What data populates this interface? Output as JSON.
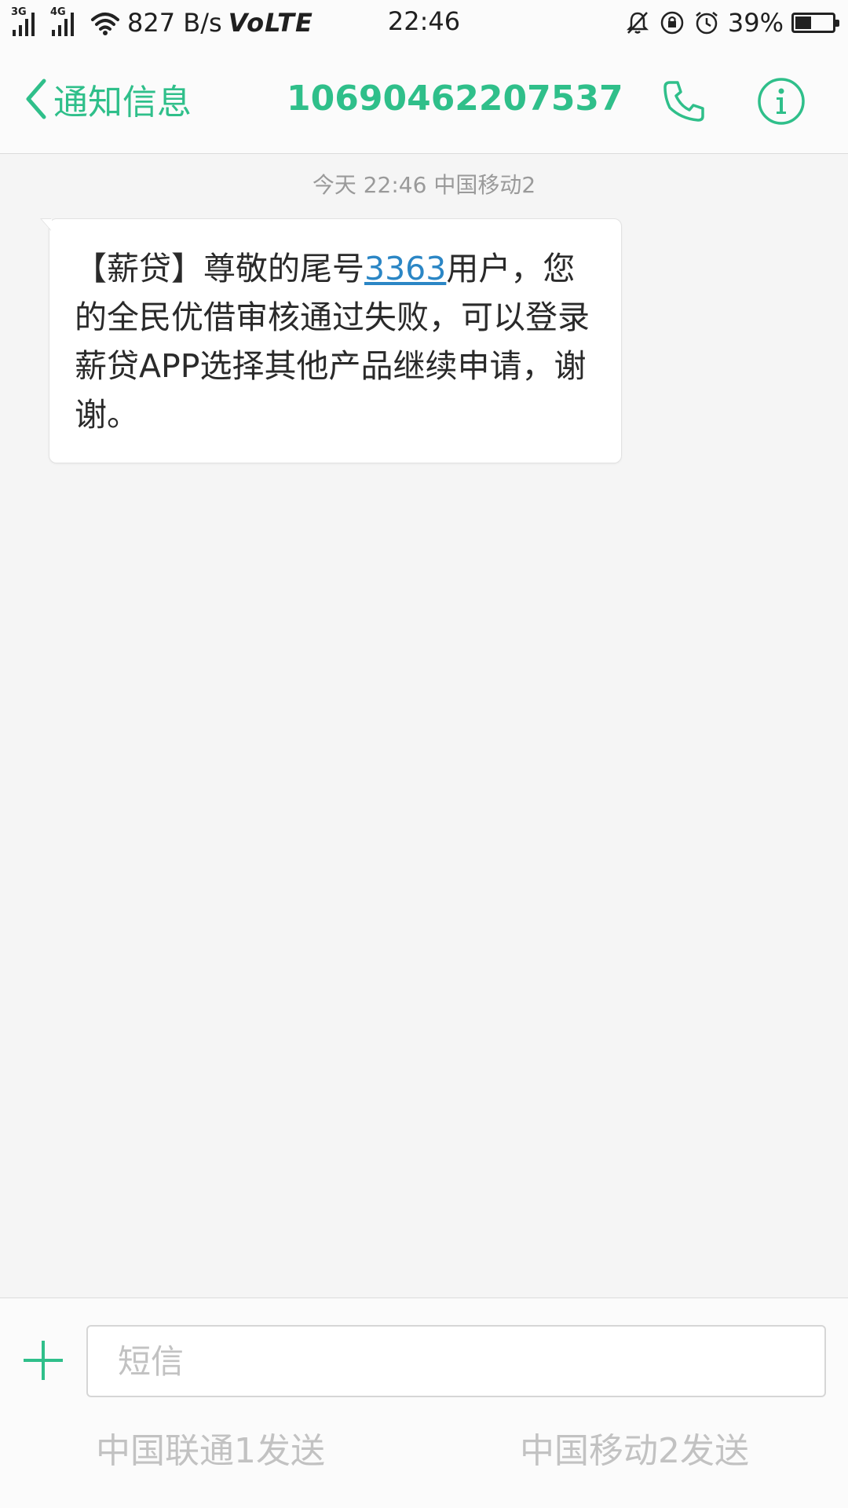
{
  "status_bar": {
    "sim1_tag": "3G",
    "sim2_tag": "4G",
    "network_speed": "827 B/s",
    "volte": "VoLTE",
    "time": "22:46",
    "battery_percent": "39%",
    "battery_level": 0.39,
    "icons": [
      "signal-icon",
      "wifi-icon",
      "mute-icon",
      "rotation-lock-icon",
      "alarm-icon",
      "battery-icon"
    ]
  },
  "header": {
    "back_label": "通知信息",
    "number": "10690462207537",
    "icons": [
      "back-chevron-icon",
      "phone-icon",
      "info-icon"
    ]
  },
  "conversation": {
    "timestamp": "今天 22:46",
    "carrier": "中国移动2",
    "message": {
      "prefix": "【薪贷】尊敬的尾号",
      "link": "3363",
      "suffix": "用户，您的全民优借审核通过失败，可以登录薪贷APP选择其他产品继续申请，谢谢。"
    }
  },
  "composer": {
    "placeholder": "短信",
    "value": "",
    "send_sim1": "中国联通1发送",
    "send_sim2": "中国移动2发送",
    "icons": [
      "plus-icon"
    ]
  },
  "colors": {
    "accent": "#2fbf8a",
    "link": "#2b86c5",
    "muted": "#c2c2c2",
    "background": "#f5f5f5"
  }
}
